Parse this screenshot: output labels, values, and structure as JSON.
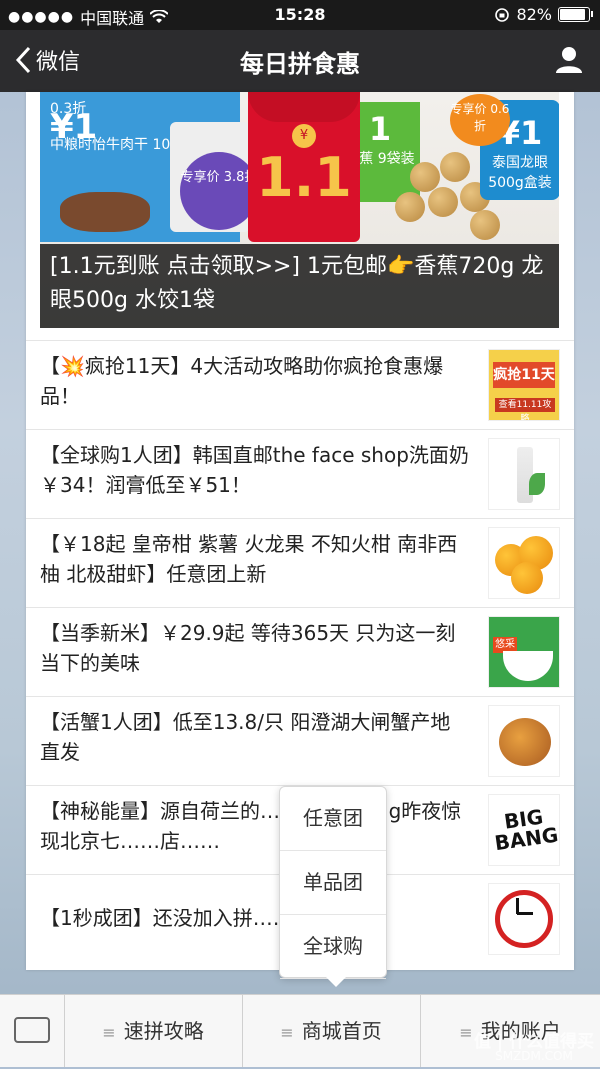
{
  "status_bar": {
    "carrier": "中国联通",
    "time": "15:28",
    "battery": "82%",
    "battery_level": 0.82
  },
  "nav": {
    "back_label": "微信",
    "title": "每日拼食惠"
  },
  "banner": {
    "price_left": "0.3折",
    "price_left_big": "¥1",
    "product_left": "中粮时怡牛肉干 100g袋装",
    "exclusive_price": "专享价 3.8折",
    "envelope_amount": "1.1",
    "right_price_label": "专享价 0.6折",
    "right_product": "泰国龙眼 500g盒装",
    "right_big": "¥1",
    "mid_product": "甜蕉 9袋装",
    "caption": "[1.1元到账 点击领取>>] 1元包邮👉香蕉720g 龙眼500g 水饺1袋"
  },
  "list": [
    {
      "text": "【💥疯抢11天】4大活动攻略助你疯抢食惠爆品！",
      "thumb_label_1": "疯抢11天",
      "thumb_label_2": "查看11.11攻略"
    },
    {
      "text": "【全球购1人团】韩国直邮the face shop洗面奶￥34！润膏低至￥51！"
    },
    {
      "text": "【￥18起 皇帝柑 紫薯 火龙果 不知火柑 南非西柚 北极甜虾】任意团上新"
    },
    {
      "text": "【当季新米】￥29.9起 等待365天 只为这一刻当下的美味",
      "thumb_label_1": "悠采"
    },
    {
      "text": "【活蟹1人团】低至13.8/只 阳澄湖大闸蟹产地直发"
    },
    {
      "text": "【神秘能量】源自荷兰的……，bigbang昨夜惊现北京七……店……",
      "thumb_label_1": "BIG BANG"
    },
    {
      "text": "【1秒成团】还没加入拼……这里~"
    }
  ],
  "popup": {
    "items": [
      "任意团",
      "单品团",
      "全球购"
    ]
  },
  "bottom_menu": {
    "items": [
      "速拼攻略",
      "商城首页",
      "我的账户"
    ]
  },
  "watermark": {
    "line1": "值 | 什么值得买",
    "line2": "SMZDM.COM"
  }
}
